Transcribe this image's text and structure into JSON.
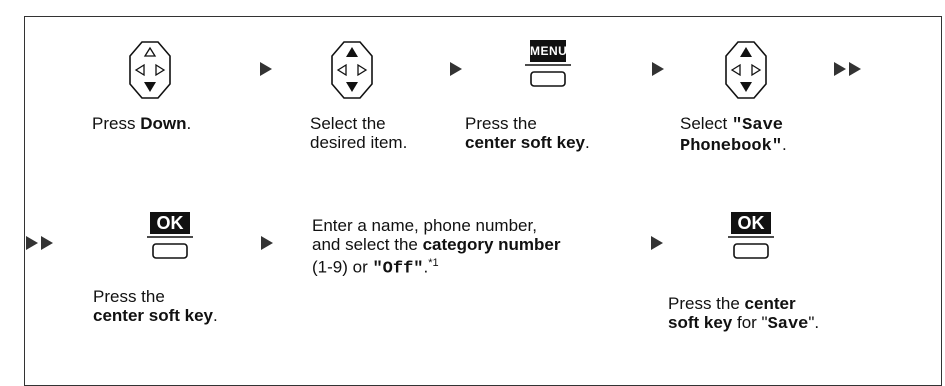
{
  "step1": {
    "pre": "Press ",
    "key": "Down",
    "post": "."
  },
  "step2": {
    "line1": "Select the",
    "line2": "desired item."
  },
  "step3": {
    "key_label": "MENU",
    "line1": "Press the",
    "key": "center soft key",
    "post": "."
  },
  "step4": {
    "line1_pre": "Select ",
    "line1_mono": "\"Save",
    "line2_mono": "Phonebook\"",
    "line2_post": "."
  },
  "step5": {
    "key_label": "OK",
    "line1": "Press the",
    "key": "center soft key",
    "post": "."
  },
  "step6": {
    "line1": "Enter a name, phone number,",
    "line2_pre": "and select the ",
    "line2_bold": "category number",
    "line3_pre": "(1-9) or ",
    "line3_mono": "\"Off\"",
    "line3_post": ".",
    "footnote": "*1"
  },
  "step7": {
    "key_label": "OK",
    "line1_pre": "Press the ",
    "line1_bold": "center",
    "line2_bold": "soft key",
    "line2_mid": " for \"",
    "line2_mono": "Save",
    "line2_post": "\"."
  },
  "icons": {
    "nav_key": "navigator-key-icon",
    "soft_key": "soft-key-icon",
    "arrow": "right-arrow-icon",
    "double_arrow": "double-right-arrow-icon"
  }
}
